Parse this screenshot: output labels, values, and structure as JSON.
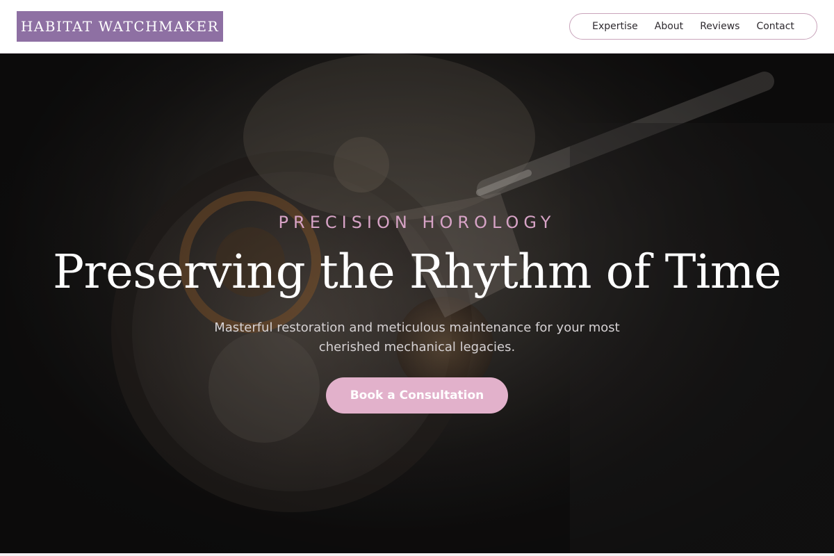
{
  "brand": {
    "name": "HABITAT WATCHMAKER"
  },
  "nav": {
    "items": [
      {
        "label": "Expertise"
      },
      {
        "label": "About"
      },
      {
        "label": "Reviews"
      },
      {
        "label": "Contact"
      }
    ]
  },
  "hero": {
    "eyebrow": "PRECISION HOROLOGY",
    "headline": "Preserving the Rhythm of Time",
    "subtext": "Masterful restoration and meticulous maintenance for your most cherished mechanical legacies.",
    "cta_label": "Book a Consultation"
  },
  "colors": {
    "brand_purple": "#8e70a3",
    "accent_pink": "#e2b1cb",
    "eyebrow_pink": "#d7a3c6",
    "nav_border": "#c9a4bb"
  }
}
